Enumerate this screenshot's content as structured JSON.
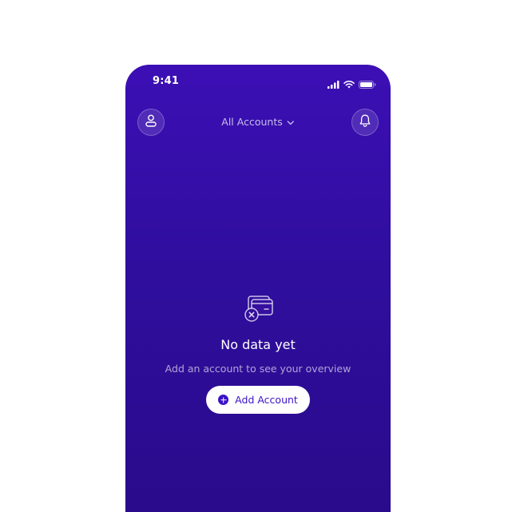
{
  "status_bar": {
    "time": "9:41",
    "icons": [
      "signal-icon",
      "wifi-icon",
      "battery-icon"
    ]
  },
  "header": {
    "profile_icon": "user-icon",
    "account_selector_label": "All Accounts",
    "account_selector_icon": "chevron-down-icon",
    "notification_icon": "bell-icon"
  },
  "empty_state": {
    "icon": "no-account-icon",
    "title": "No data yet",
    "subtitle": "Add an account to see your overview",
    "button_label": "Add Account",
    "button_icon": "plus-circle-icon"
  },
  "colors": {
    "background_top": "#3c0fb5",
    "background_bottom": "#2a0b8b",
    "accent": "#3b12c8",
    "button_background": "#ffffff"
  }
}
